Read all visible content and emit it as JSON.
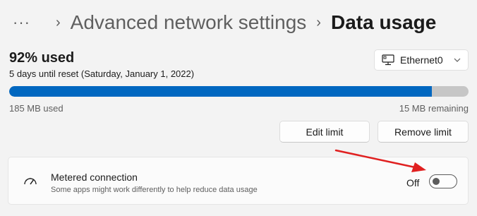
{
  "breadcrumb": {
    "overflow": "···",
    "parent": "Advanced network settings",
    "current": "Data usage"
  },
  "usage": {
    "percent_used_label": "92% used",
    "percent_used": 92,
    "reset_text": "5 days until reset (Saturday, January 1, 2022)",
    "used_amount": "185 MB used",
    "remaining": "15 MB remaining"
  },
  "adapter": {
    "selected": "Ethernet0",
    "icon": "monitor-icon"
  },
  "buttons": {
    "edit_limit": "Edit limit",
    "remove_limit": "Remove limit"
  },
  "metered": {
    "title": "Metered connection",
    "description": "Some apps might work differently to help reduce data usage",
    "state": "Off",
    "enabled": false,
    "icon": "gauge-icon"
  },
  "colors": {
    "accent": "#0067c0",
    "annotation_arrow": "#e02020"
  }
}
